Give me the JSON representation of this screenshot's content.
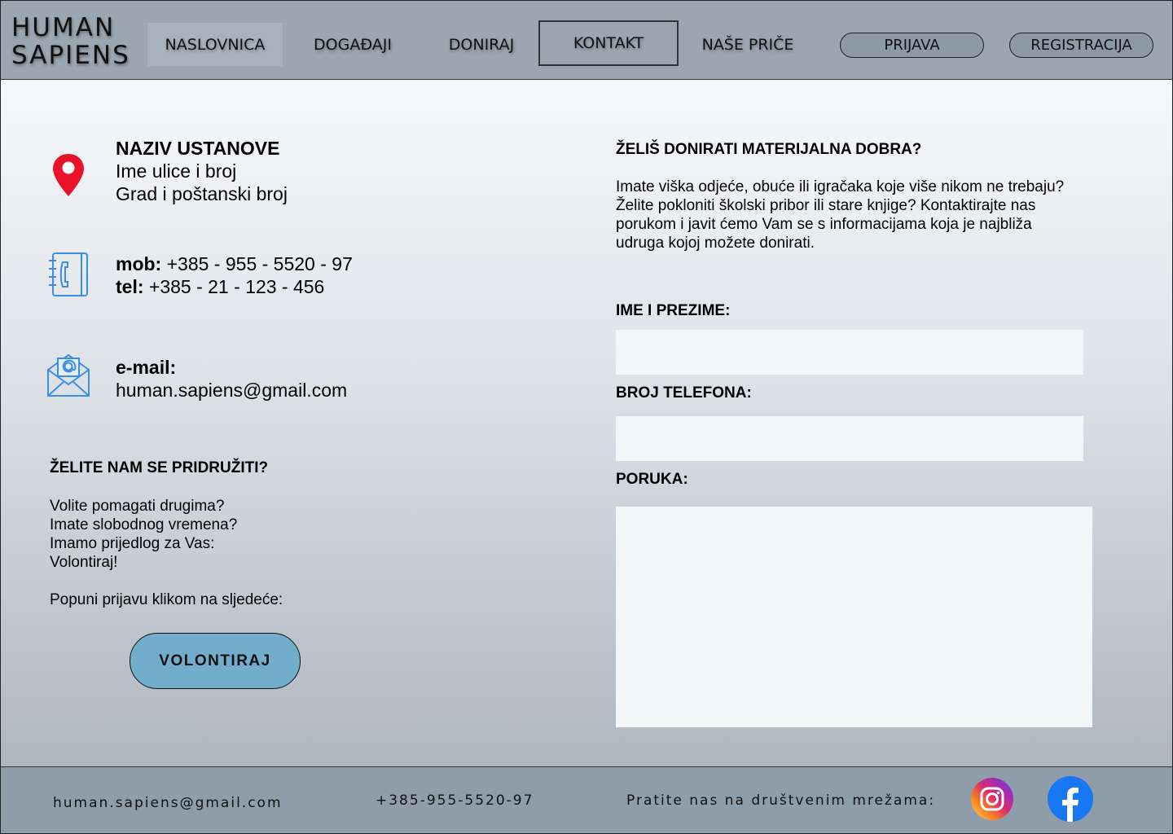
{
  "header": {
    "logo_line1": "HUMAN",
    "logo_line2": "SAPIENS",
    "nav": {
      "home": "NASLOVNICA",
      "events": "DOGAĐAJI",
      "donate": "DONIRAJ",
      "contact": "KONTAKT",
      "stories": "NAŠE PRIČE"
    },
    "login": "PRIJAVA",
    "register": "REGISTRACIJA"
  },
  "address": {
    "name": "NAZIV USTANOVE",
    "street": "Ime ulice i broj",
    "city": "Grad i poštanski broj"
  },
  "phones": {
    "mob_label": "mob:",
    "mob_value": " +385 - 955 - 5520 - 97",
    "tel_label": "tel:",
    "tel_value": " +385 - 21 - 123 - 456"
  },
  "email": {
    "label": "e-mail:",
    "value": "human.sapiens@gmail.com"
  },
  "join": {
    "title": "ŽELITE NAM SE PRIDRUŽITI?",
    "line1": "Volite pomagati drugima?",
    "line2": "Imate slobodnog vremena?",
    "line3": "Imamo prijedlog za Vas:",
    "line4": "Volontiraj!",
    "line5": "Popuni prijavu klikom na sljedeće:",
    "button": "VOLONTIRAJ"
  },
  "donate": {
    "title": "ŽELIŠ DONIRATI MATERIJALNA DOBRA?",
    "text": "Imate viška odjeće, obuće ili igračaka koje više nikom ne trebaju? Želite pokloniti školski pribor ili stare knjige? Kontaktirajte nas porukom i javit ćemo Vam se s informacijama koja je najbliža udruga kojoj možete donirati."
  },
  "form": {
    "name_label": "IME I PREZIME:",
    "name_value": "",
    "phone_label": "BROJ TELEFONA:",
    "phone_value": "",
    "message_label": "PORUKA:",
    "message_value": ""
  },
  "footer": {
    "email": "human.sapiens@gmail.com",
    "phone": "+385-955-5520-97",
    "follow": "Pratite nas na društvenim mrežama:"
  },
  "colors": {
    "header_bg": "#9ba6b1",
    "footer_bg": "#8f9ca9",
    "button_bg": "#72aecb",
    "pin_red": "#e8132b",
    "icon_blue": "#3a8ee6",
    "facebook_blue": "#1877f2"
  },
  "icons": {
    "location": "location-pin-icon",
    "phone": "phone-book-icon",
    "email": "email-envelope-icon",
    "instagram": "instagram-icon",
    "facebook": "facebook-icon"
  }
}
